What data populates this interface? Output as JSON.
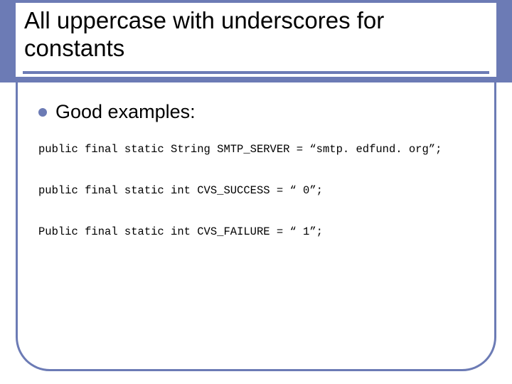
{
  "title": "All uppercase with underscores for constants",
  "lead": "Good examples:",
  "code_lines": {
    "l0": "public final static String SMTP_SERVER = “smtp. edfund. org”;",
    "l1": "public final static int CVS_SUCCESS = “ 0”;",
    "l2": "Public final static int CVS_FAILURE = “ 1”;"
  }
}
